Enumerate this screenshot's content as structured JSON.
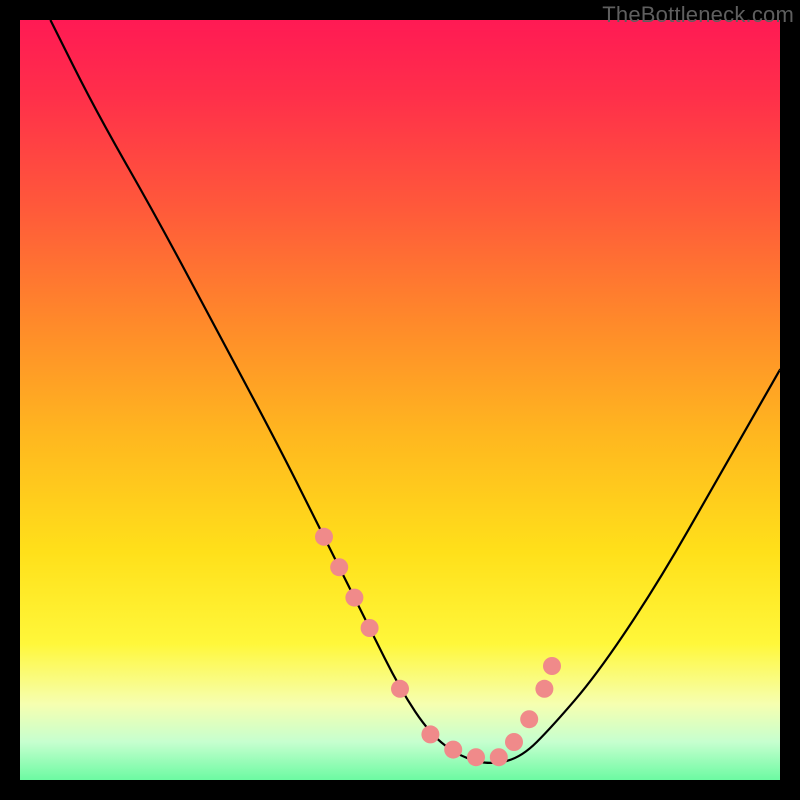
{
  "watermark": "TheBottleneck.com",
  "chart_data": {
    "type": "line",
    "title": "",
    "xlabel": "",
    "ylabel": "",
    "xlim": [
      0,
      100
    ],
    "ylim": [
      0,
      100
    ],
    "series": [
      {
        "name": "bottleneck-curve",
        "x": [
          4,
          10,
          18,
          26,
          34,
          40,
          46,
          50,
          54,
          58,
          62,
          66,
          70,
          76,
          84,
          92,
          100
        ],
        "y": [
          100,
          88,
          74,
          59,
          44,
          32,
          20,
          12,
          6,
          3,
          2,
          3,
          7,
          14,
          26,
          40,
          54
        ]
      }
    ],
    "markers": {
      "name": "highlight-dots",
      "color": "#f08a8a",
      "x": [
        40,
        42,
        44,
        46,
        50,
        54,
        57,
        60,
        63,
        65,
        67,
        69,
        70
      ],
      "y": [
        32,
        28,
        24,
        20,
        12,
        6,
        4,
        3,
        3,
        5,
        8,
        12,
        15
      ]
    }
  }
}
